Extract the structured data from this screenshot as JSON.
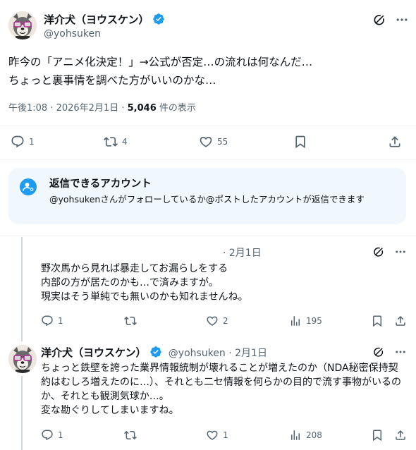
{
  "main_tweet": {
    "author_name": "洋介犬（ヨウスケン）",
    "handle": "@yohsuken",
    "text": "昨今の「アニメ化決定！」→公式が否定…の流れは何なんだ…\nちょっと裏事情を調べた方がいいのかな…",
    "timestamp": "午後1:08 · 2026年2月1日 · ",
    "views_count": "5,046",
    "views_label": " 件の表示",
    "replies": "1",
    "reposts": "4",
    "likes": "55"
  },
  "reply_notice": {
    "title": "返信できるアカウント",
    "description": "@yohsukenさんがフォローしているか@ポストしたアカウントが返信できます"
  },
  "replies": [
    {
      "date": "· 2月1日",
      "text": "野次馬から見れば暴走してお漏らしをする\n内部の方が居たのかも…で済みますが。\n現実はそう単純でも無いのかも知れませんね。",
      "replies": "1",
      "reposts": "",
      "likes": "2",
      "views": "195"
    },
    {
      "author_name": "洋介犬（ヨウスケン）",
      "handle_date": "@yohsuken · 2月1日",
      "text": "ちょっと鉄壁を誇った業界情報統制が壊れることが増えたのか（NDA秘密保持契約はむしろ増えたのに…）、それとも二セ情報を何らかの目的で流す事物がいるのか、それとも観測気球か…。\n変な勘ぐりしてしまいますね。",
      "replies": "1",
      "reposts": "",
      "likes": "1",
      "views": "208"
    }
  ],
  "colors": {
    "accent": "#1d9bf0",
    "text": "#0f1419",
    "secondary": "#536471",
    "notice_bg": "#f1f8fd"
  }
}
